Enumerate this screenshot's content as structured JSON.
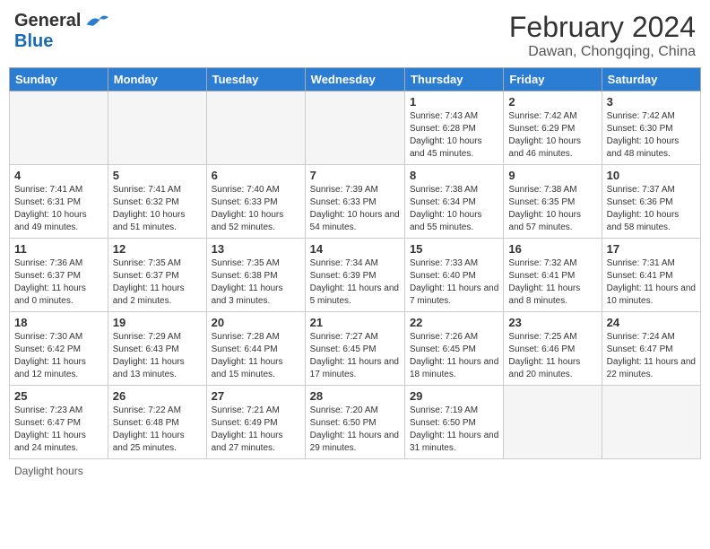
{
  "header": {
    "logo_general": "General",
    "logo_blue": "Blue",
    "month_year": "February 2024",
    "location": "Dawan, Chongqing, China"
  },
  "footer": {
    "daylight_hours": "Daylight hours"
  },
  "days_of_week": [
    "Sunday",
    "Monday",
    "Tuesday",
    "Wednesday",
    "Thursday",
    "Friday",
    "Saturday"
  ],
  "weeks": [
    {
      "days": [
        {
          "num": "",
          "empty": true
        },
        {
          "num": "",
          "empty": true
        },
        {
          "num": "",
          "empty": true
        },
        {
          "num": "",
          "empty": true
        },
        {
          "num": "1",
          "sunrise": "Sunrise: 7:43 AM",
          "sunset": "Sunset: 6:28 PM",
          "daylight": "Daylight: 10 hours and 45 minutes."
        },
        {
          "num": "2",
          "sunrise": "Sunrise: 7:42 AM",
          "sunset": "Sunset: 6:29 PM",
          "daylight": "Daylight: 10 hours and 46 minutes."
        },
        {
          "num": "3",
          "sunrise": "Sunrise: 7:42 AM",
          "sunset": "Sunset: 6:30 PM",
          "daylight": "Daylight: 10 hours and 48 minutes."
        }
      ]
    },
    {
      "days": [
        {
          "num": "4",
          "sunrise": "Sunrise: 7:41 AM",
          "sunset": "Sunset: 6:31 PM",
          "daylight": "Daylight: 10 hours and 49 minutes."
        },
        {
          "num": "5",
          "sunrise": "Sunrise: 7:41 AM",
          "sunset": "Sunset: 6:32 PM",
          "daylight": "Daylight: 10 hours and 51 minutes."
        },
        {
          "num": "6",
          "sunrise": "Sunrise: 7:40 AM",
          "sunset": "Sunset: 6:33 PM",
          "daylight": "Daylight: 10 hours and 52 minutes."
        },
        {
          "num": "7",
          "sunrise": "Sunrise: 7:39 AM",
          "sunset": "Sunset: 6:33 PM",
          "daylight": "Daylight: 10 hours and 54 minutes."
        },
        {
          "num": "8",
          "sunrise": "Sunrise: 7:38 AM",
          "sunset": "Sunset: 6:34 PM",
          "daylight": "Daylight: 10 hours and 55 minutes."
        },
        {
          "num": "9",
          "sunrise": "Sunrise: 7:38 AM",
          "sunset": "Sunset: 6:35 PM",
          "daylight": "Daylight: 10 hours and 57 minutes."
        },
        {
          "num": "10",
          "sunrise": "Sunrise: 7:37 AM",
          "sunset": "Sunset: 6:36 PM",
          "daylight": "Daylight: 10 hours and 58 minutes."
        }
      ]
    },
    {
      "days": [
        {
          "num": "11",
          "sunrise": "Sunrise: 7:36 AM",
          "sunset": "Sunset: 6:37 PM",
          "daylight": "Daylight: 11 hours and 0 minutes."
        },
        {
          "num": "12",
          "sunrise": "Sunrise: 7:35 AM",
          "sunset": "Sunset: 6:37 PM",
          "daylight": "Daylight: 11 hours and 2 minutes."
        },
        {
          "num": "13",
          "sunrise": "Sunrise: 7:35 AM",
          "sunset": "Sunset: 6:38 PM",
          "daylight": "Daylight: 11 hours and 3 minutes."
        },
        {
          "num": "14",
          "sunrise": "Sunrise: 7:34 AM",
          "sunset": "Sunset: 6:39 PM",
          "daylight": "Daylight: 11 hours and 5 minutes."
        },
        {
          "num": "15",
          "sunrise": "Sunrise: 7:33 AM",
          "sunset": "Sunset: 6:40 PM",
          "daylight": "Daylight: 11 hours and 7 minutes."
        },
        {
          "num": "16",
          "sunrise": "Sunrise: 7:32 AM",
          "sunset": "Sunset: 6:41 PM",
          "daylight": "Daylight: 11 hours and 8 minutes."
        },
        {
          "num": "17",
          "sunrise": "Sunrise: 7:31 AM",
          "sunset": "Sunset: 6:41 PM",
          "daylight": "Daylight: 11 hours and 10 minutes."
        }
      ]
    },
    {
      "days": [
        {
          "num": "18",
          "sunrise": "Sunrise: 7:30 AM",
          "sunset": "Sunset: 6:42 PM",
          "daylight": "Daylight: 11 hours and 12 minutes."
        },
        {
          "num": "19",
          "sunrise": "Sunrise: 7:29 AM",
          "sunset": "Sunset: 6:43 PM",
          "daylight": "Daylight: 11 hours and 13 minutes."
        },
        {
          "num": "20",
          "sunrise": "Sunrise: 7:28 AM",
          "sunset": "Sunset: 6:44 PM",
          "daylight": "Daylight: 11 hours and 15 minutes."
        },
        {
          "num": "21",
          "sunrise": "Sunrise: 7:27 AM",
          "sunset": "Sunset: 6:45 PM",
          "daylight": "Daylight: 11 hours and 17 minutes."
        },
        {
          "num": "22",
          "sunrise": "Sunrise: 7:26 AM",
          "sunset": "Sunset: 6:45 PM",
          "daylight": "Daylight: 11 hours and 18 minutes."
        },
        {
          "num": "23",
          "sunrise": "Sunrise: 7:25 AM",
          "sunset": "Sunset: 6:46 PM",
          "daylight": "Daylight: 11 hours and 20 minutes."
        },
        {
          "num": "24",
          "sunrise": "Sunrise: 7:24 AM",
          "sunset": "Sunset: 6:47 PM",
          "daylight": "Daylight: 11 hours and 22 minutes."
        }
      ]
    },
    {
      "days": [
        {
          "num": "25",
          "sunrise": "Sunrise: 7:23 AM",
          "sunset": "Sunset: 6:47 PM",
          "daylight": "Daylight: 11 hours and 24 minutes."
        },
        {
          "num": "26",
          "sunrise": "Sunrise: 7:22 AM",
          "sunset": "Sunset: 6:48 PM",
          "daylight": "Daylight: 11 hours and 25 minutes."
        },
        {
          "num": "27",
          "sunrise": "Sunrise: 7:21 AM",
          "sunset": "Sunset: 6:49 PM",
          "daylight": "Daylight: 11 hours and 27 minutes."
        },
        {
          "num": "28",
          "sunrise": "Sunrise: 7:20 AM",
          "sunset": "Sunset: 6:50 PM",
          "daylight": "Daylight: 11 hours and 29 minutes."
        },
        {
          "num": "29",
          "sunrise": "Sunrise: 7:19 AM",
          "sunset": "Sunset: 6:50 PM",
          "daylight": "Daylight: 11 hours and 31 minutes."
        },
        {
          "num": "",
          "empty": true
        },
        {
          "num": "",
          "empty": true
        }
      ]
    }
  ]
}
